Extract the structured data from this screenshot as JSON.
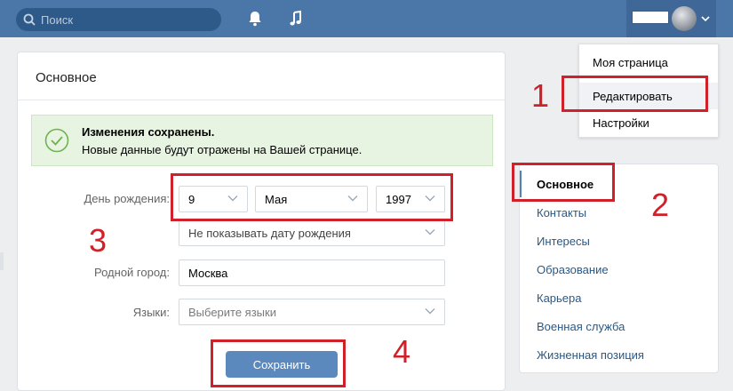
{
  "search": {
    "placeholder": "Поиск"
  },
  "icons": {
    "search": "search-icon",
    "bell": "bell-icon",
    "music": "music-icon",
    "chevron": "chevron-down-icon",
    "check": "check-circle-icon"
  },
  "colors": {
    "header": "#4a76a8",
    "accent": "#5181b8",
    "success_bg": "#e8f4e2",
    "annotation": "#d0202a"
  },
  "dropdown": {
    "items": [
      {
        "label": "Моя страница"
      },
      {
        "label": "Редактировать"
      },
      {
        "label": "Настройки"
      }
    ]
  },
  "main": {
    "title": "Основное",
    "alert": {
      "title": "Изменения сохранены.",
      "text": "Новые данные будут отражены на Вашей странице."
    },
    "birthday": {
      "label": "День рождения:",
      "day": "9",
      "month": "Мая",
      "year": "1997",
      "visibility": "Не показывать дату рождения"
    },
    "hometown": {
      "label": "Родной город:",
      "value": "Москва"
    },
    "languages": {
      "label": "Языки:",
      "placeholder": "Выберите языки"
    },
    "save_label": "Сохранить"
  },
  "side_menu": {
    "items": [
      {
        "label": "Основное"
      },
      {
        "label": "Контакты"
      },
      {
        "label": "Интересы"
      },
      {
        "label": "Образование"
      },
      {
        "label": "Карьера"
      },
      {
        "label": "Военная служба"
      },
      {
        "label": "Жизненная позиция"
      }
    ]
  },
  "annotations": {
    "n1": "1",
    "n2": "2",
    "n3": "3",
    "n4": "4"
  }
}
